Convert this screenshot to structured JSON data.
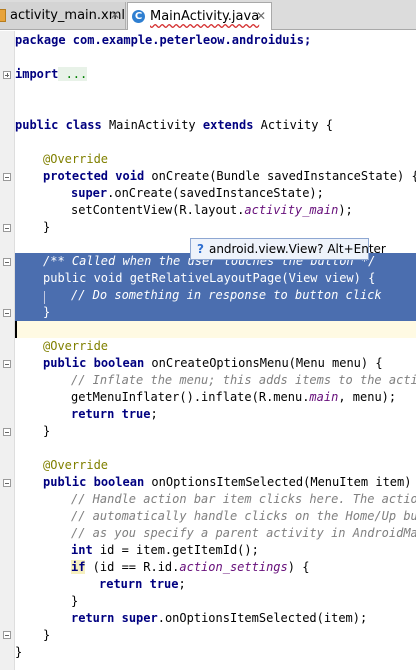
{
  "tabs": [
    {
      "label": "activity_main.xml",
      "icon": "xml-file-icon",
      "active": false
    },
    {
      "label": "MainActivity.java",
      "icon": "java-class-icon",
      "active": true
    }
  ],
  "tooltip": {
    "text": "android.view.View? Alt+Enter",
    "icon": "question-icon"
  },
  "code": {
    "l1": [
      "package com.example.peterleow.androiduis;"
    ],
    "l2": [
      "import",
      " ..."
    ],
    "l3": [
      "public",
      " ",
      "class",
      " MainActivity ",
      "extends",
      " Activity {"
    ],
    "l4": [
      "@Override"
    ],
    "l5": [
      "protected",
      " ",
      "void",
      " onCreate(Bundle savedInstanceState) {"
    ],
    "l6": [
      "super",
      ".onCreate(savedInstanceState);"
    ],
    "l7": [
      "setContentView(R.layout.",
      "activity_main",
      ");"
    ],
    "l8": [
      "}"
    ],
    "l9": [
      "/** Called when the user touches the button */"
    ],
    "l10": [
      "public void getRelativeLayoutPage(View view) {"
    ],
    "l11": [
      "// Do something in response to button click"
    ],
    "l12": [
      "}"
    ],
    "l13": [
      "@Override"
    ],
    "l14": [
      "public",
      " ",
      "boolean",
      " onCreateOptionsMenu(Menu menu) {"
    ],
    "l15": [
      "// Inflate the menu; this adds items to the action"
    ],
    "l16": [
      "getMenuInflater().inflate(R.menu.",
      "main",
      ", menu);"
    ],
    "l17": [
      "return",
      " ",
      "true",
      ";"
    ],
    "l18": [
      "}"
    ],
    "l19": [
      "@Override"
    ],
    "l20": [
      "public",
      " ",
      "boolean",
      " onOptionsItemSelected(MenuItem item) {"
    ],
    "l21": [
      "// Handle action bar item clicks here. The action"
    ],
    "l22": [
      "// automatically handle clicks on the Home/Up butt"
    ],
    "l23": [
      "// as you specify a parent activity in AndroidMani"
    ],
    "l24": [
      "int",
      " id = item.getItemId();"
    ],
    "l25": [
      "if",
      " (id == R.id.",
      "action_settings",
      ") {"
    ],
    "l26": [
      "return",
      " ",
      "true",
      ";"
    ],
    "l27": [
      "}"
    ],
    "l28": [
      "return",
      " ",
      "super",
      ".onOptionsItemSelected(item);"
    ],
    "l29": [
      "}"
    ],
    "l30": [
      "}"
    ]
  }
}
